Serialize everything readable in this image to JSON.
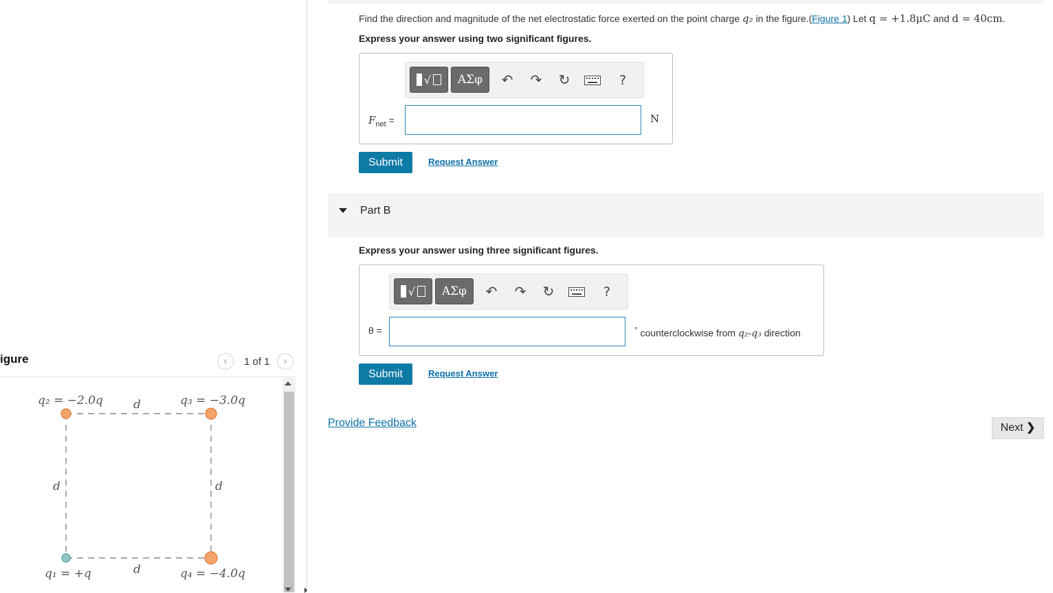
{
  "figure_panel": {
    "title": "igure",
    "counter": "1 of 1",
    "prev_icon": "chevron-left-icon",
    "next_icon": "chevron-right-icon",
    "labels": {
      "q2": "q₂ = −2.0q",
      "q3": "q₃ = −3.0q",
      "q1": "q₁ = +q",
      "q4": "q₄ = −4.0q",
      "d_top": "d",
      "d_bottom": "d",
      "d_left": "d",
      "d_right": "d"
    },
    "colors": {
      "negative_charge": "#f4a46a",
      "positive_charge": "#8fc9c6",
      "dashed_line": "#8a8a8a"
    }
  },
  "part_a": {
    "problem_prefix": "Find the direction and magnitude of the net electrostatic force exerted on the point charge ",
    "problem_charge": "q₂",
    "problem_mid": " in the figure.(",
    "figure_link": "Figure 1",
    "problem_after_link": ") Let ",
    "q_value": "q = +1.8μC",
    "and_text": " and ",
    "d_value": "d = 40cm",
    "period": ".",
    "instruction": "Express your answer using two significant figures.",
    "label": "F",
    "label_sub": "net",
    "label_eq": " =",
    "input_value": "",
    "unit": "N",
    "submit": "Submit",
    "request_answer": "Request Answer"
  },
  "part_b": {
    "title": "Part B",
    "instruction": "Express your answer using three significant figures.",
    "label": "θ =",
    "input_value": "",
    "unit_degree": "°",
    "unit_text": " counterclockwise from ",
    "unit_charges": "q₂-q₃",
    "unit_end": " direction",
    "submit": "Submit",
    "request_answer": "Request Answer"
  },
  "toolbar": {
    "greek": "ΑΣφ",
    "undo_icon": "undo-icon",
    "redo_icon": "redo-icon",
    "reset_icon": "reset-icon",
    "keyboard_icon": "keyboard-icon",
    "help": "?"
  },
  "footer": {
    "feedback": "Provide Feedback",
    "next": "Next"
  }
}
